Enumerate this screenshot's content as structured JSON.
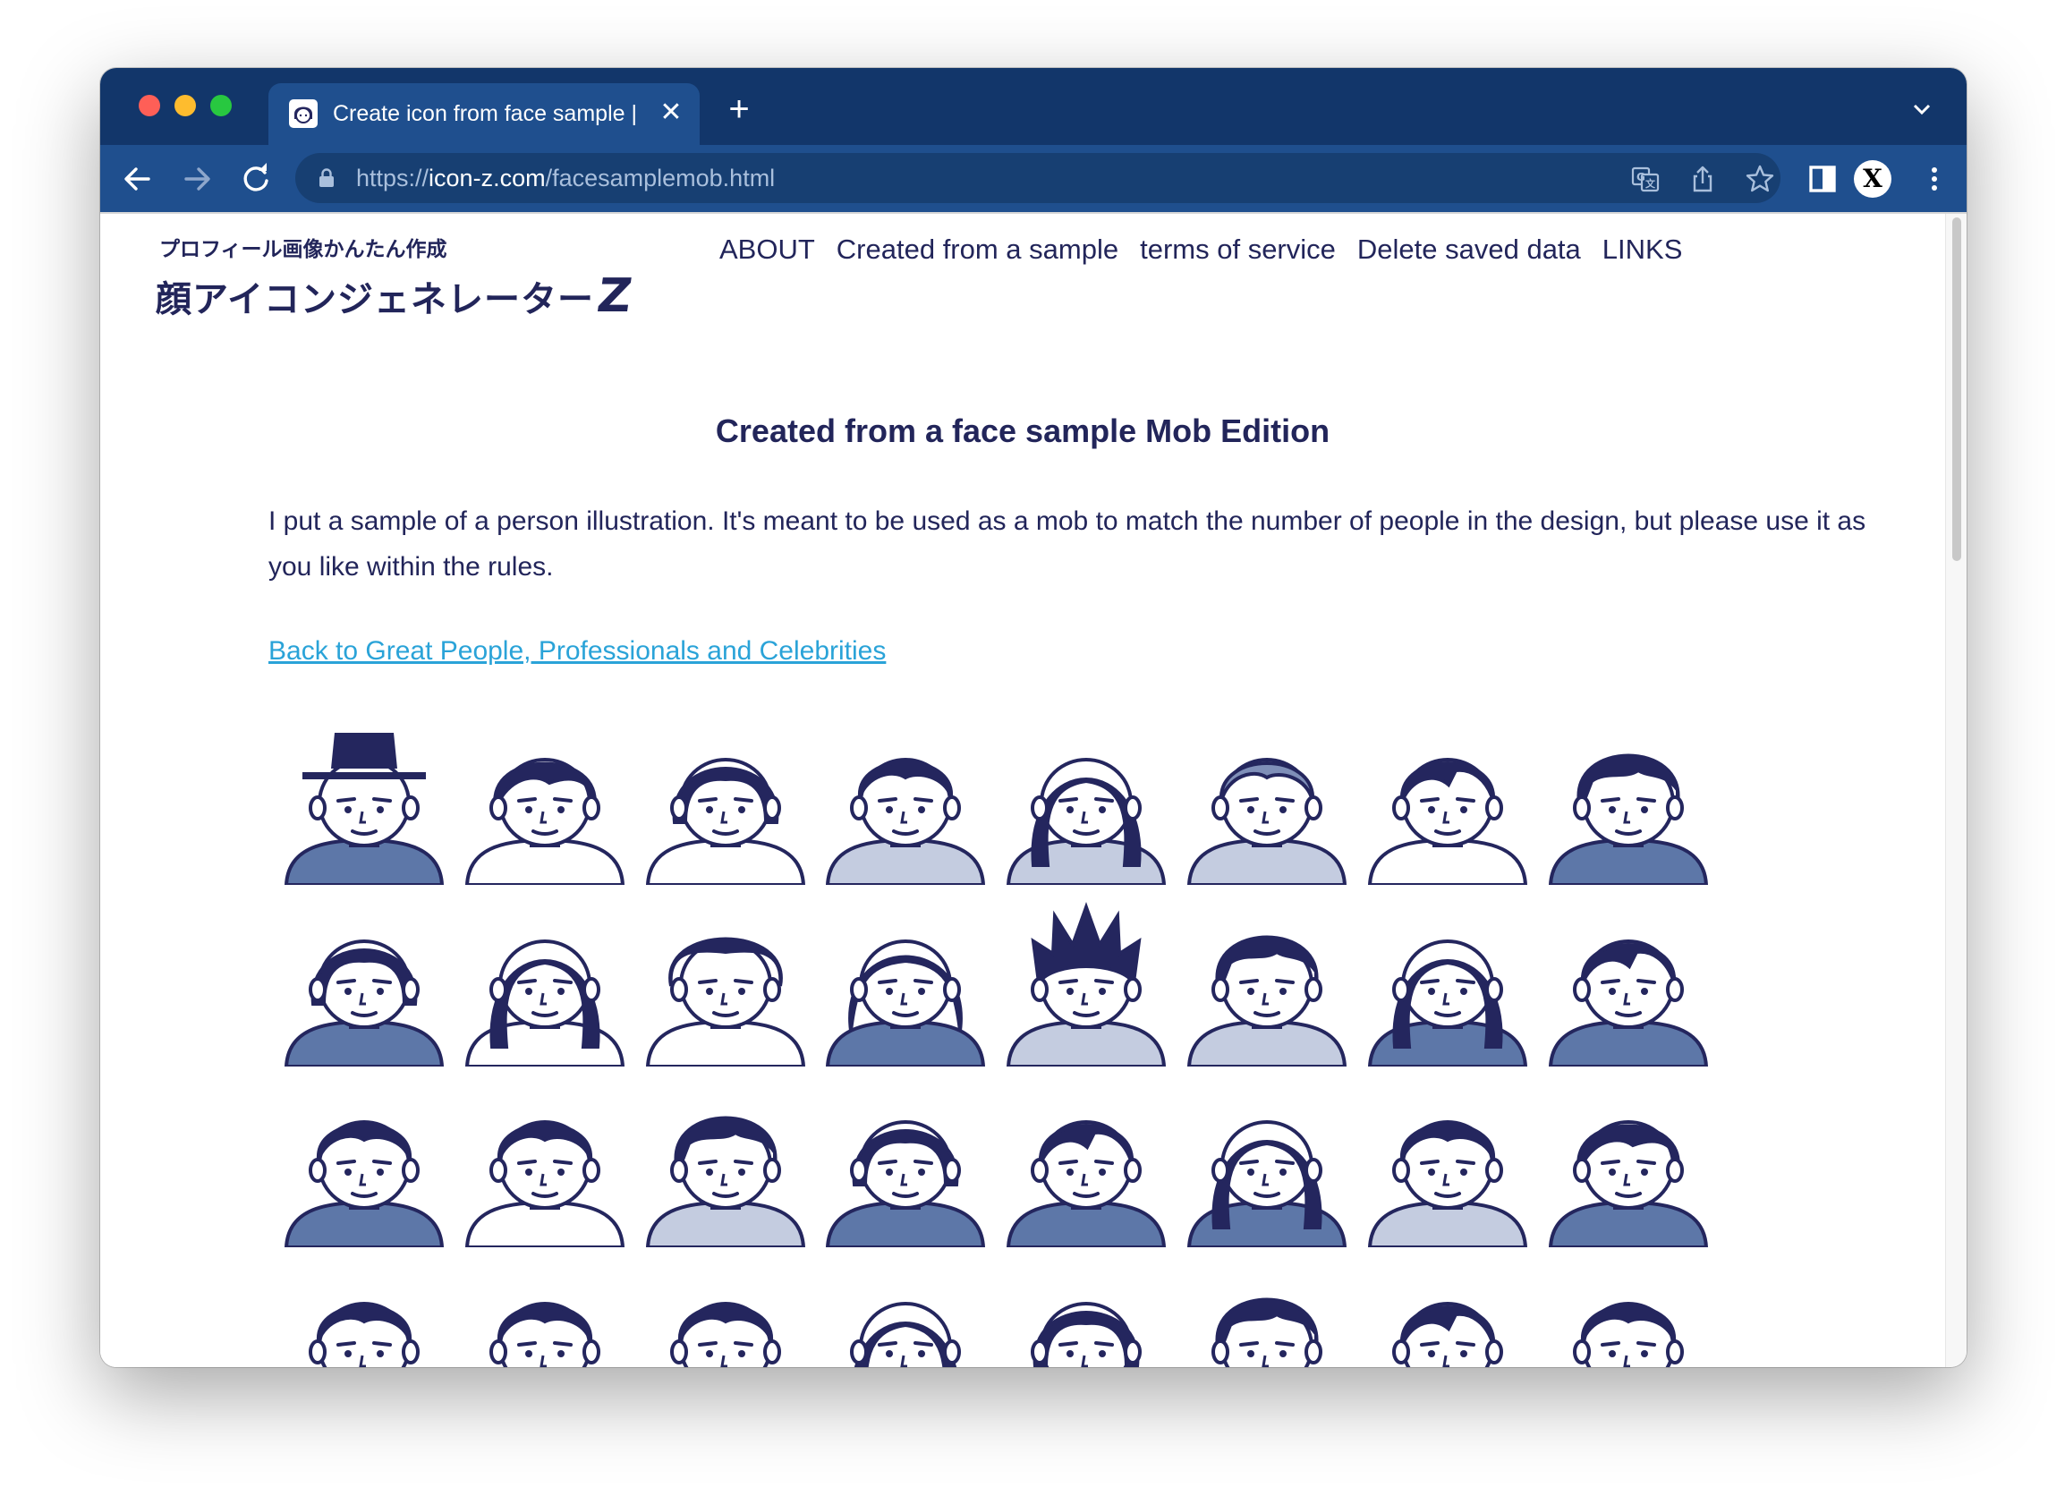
{
  "browser": {
    "tab_title": "Create icon from face sample |",
    "url_scheme": "https://",
    "url_host": "icon-z.com",
    "url_path": "/facesamplemob.html",
    "profile_initial": "X",
    "colors": {
      "tabbar": "#12366a",
      "toolbar": "#1f4f8e",
      "omnibox": "#173f72"
    }
  },
  "site": {
    "logo_sub": "プロフィール画像かんたん作成",
    "logo_main": "顔アイコンジェネレーター",
    "logo_z": "Z",
    "nav": [
      "ABOUT",
      "Created from a sample",
      "terms of service",
      "Delete saved data",
      "LINKS"
    ]
  },
  "page": {
    "title": "Created from a face sample Mob Edition",
    "intro": "I put a sample of a person illustration. It's meant to be used as a mob to match the number of people in the design, but please use it as you like within the rules.",
    "back_link": "Back to Great People, Professionals and Celebrities"
  },
  "colors": {
    "text": "#22255a",
    "link": "#2aa3d8",
    "ink": "#24265e",
    "shirt_blue": "#5d77a8",
    "shirt_light": "#c4cce0"
  },
  "faces": [
    {
      "hair": "hat",
      "shirt": "blue"
    },
    {
      "hair": "wavy",
      "shirt": "white"
    },
    {
      "hair": "bob",
      "shirt": "white"
    },
    {
      "hair": "short",
      "shirt": "light"
    },
    {
      "hair": "long",
      "shirt": "light"
    },
    {
      "hair": "gray",
      "shirt": "light"
    },
    {
      "hair": "parted",
      "shirt": "white"
    },
    {
      "hair": "messy",
      "shirt": "blue"
    },
    {
      "hair": "bob",
      "shirt": "blue"
    },
    {
      "hair": "long",
      "shirt": "white"
    },
    {
      "hair": "afro",
      "shirt": "white"
    },
    {
      "hair": "curly",
      "shirt": "blue"
    },
    {
      "hair": "spiky",
      "shirt": "light"
    },
    {
      "hair": "messy",
      "shirt": "light"
    },
    {
      "hair": "long",
      "shirt": "blue"
    },
    {
      "hair": "parted",
      "shirt": "blue"
    },
    {
      "hair": "short",
      "shirt": "blue"
    },
    {
      "hair": "short",
      "shirt": "white"
    },
    {
      "hair": "messy",
      "shirt": "light"
    },
    {
      "hair": "bob",
      "shirt": "blue"
    },
    {
      "hair": "parted",
      "shirt": "blue"
    },
    {
      "hair": "long",
      "shirt": "blue"
    },
    {
      "hair": "short",
      "shirt": "light"
    },
    {
      "hair": "wavy",
      "shirt": "blue"
    },
    {
      "hair": "short",
      "shirt": "blue"
    },
    {
      "hair": "short",
      "shirt": "white"
    },
    {
      "hair": "short",
      "shirt": "white"
    },
    {
      "hair": "long",
      "shirt": "white"
    },
    {
      "hair": "bob",
      "shirt": "white"
    },
    {
      "hair": "messy",
      "shirt": "white"
    },
    {
      "hair": "parted",
      "shirt": "white"
    },
    {
      "hair": "short",
      "shirt": "white"
    }
  ]
}
